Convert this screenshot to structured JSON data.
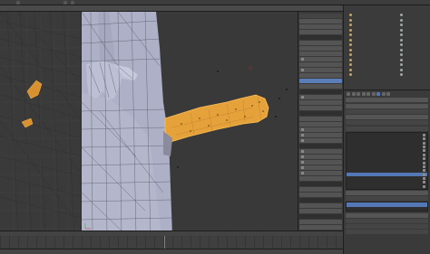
{
  "topbar": {
    "menus": [
      "",
      "",
      "",
      "",
      "",
      ""
    ],
    "scene_select": "",
    "render_select": "",
    "engine_select": ""
  },
  "properties": {
    "rows": [
      "",
      "",
      "",
      "",
      "",
      "",
      "",
      "",
      "",
      "",
      "",
      "",
      "",
      "",
      "",
      "",
      "",
      "",
      "",
      "",
      "",
      "",
      "",
      "",
      "",
      "",
      "",
      "",
      "",
      "",
      "",
      "",
      "",
      "",
      "",
      "",
      "",
      "",
      "",
      ""
    ]
  },
  "outliner": {
    "items": [
      "",
      "",
      "",
      "",
      "",
      "",
      "",
      "",
      "",
      "",
      "",
      "",
      ""
    ]
  },
  "property_editor": {
    "object_field": "",
    "mesh_name": "",
    "vertex_groups_header": "",
    "vertex_groups": [
      "",
      "",
      "",
      "",
      "",
      "",
      "",
      "",
      "",
      "",
      "",
      "",
      "",
      ""
    ],
    "selected_group_index": 10,
    "shape_keys_header": "",
    "shape_keys": [
      "",
      ""
    ],
    "extra_fields": [
      "",
      "",
      "",
      "",
      "",
      "",
      "",
      ""
    ]
  },
  "timeline": {
    "header": [
      "",
      "",
      "",
      "",
      "",
      ""
    ],
    "footer": [
      "",
      "",
      "",
      "",
      "",
      "",
      "",
      "",
      ""
    ],
    "current_frame_fraction": 0.48
  },
  "viewport": {
    "selection_color": "#e6a23a",
    "mesh_color": "#aeb0c8",
    "background_color": "#393939"
  }
}
